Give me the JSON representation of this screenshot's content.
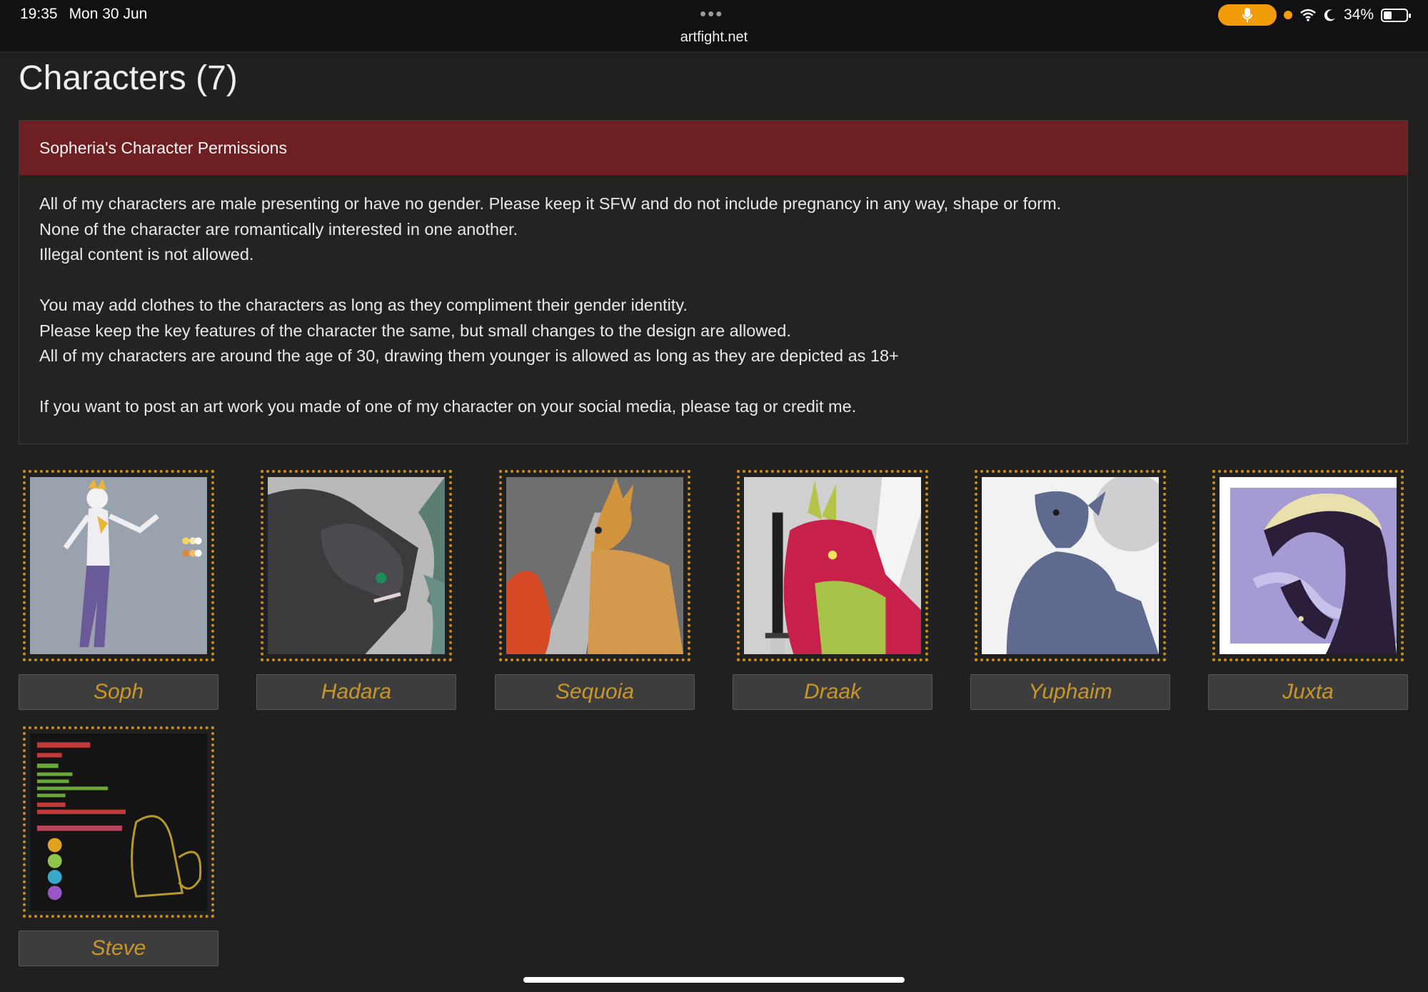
{
  "status_bar": {
    "time": "19:35",
    "date": "Mon 30 Jun",
    "url": "artfight.net",
    "battery": "34%"
  },
  "page": {
    "title": "Characters (7)"
  },
  "permissions": {
    "header": "Sopheria's Character Permissions",
    "lines": [
      "All of my characters are male presenting or have no gender. Please keep it SFW and do not include pregnancy in any way, shape or form.",
      "None of the character are romantically interested in one another.",
      "Illegal content is not allowed.",
      "You may add clothes to the characters as long as they compliment their gender identity.",
      "Please keep the key features of the character the same, but small changes to the design are allowed.",
      "All of my characters are around the age of 30, drawing them younger is allowed as long as they are depicted as 18+",
      "If you want to post an art work you made of one of my character on your social media, please tag or credit me."
    ]
  },
  "characters": [
    {
      "name": "Soph"
    },
    {
      "name": "Hadara"
    },
    {
      "name": "Sequoia"
    },
    {
      "name": "Draak"
    },
    {
      "name": "Yuphaim"
    },
    {
      "name": "Juxta"
    },
    {
      "name": "Steve"
    }
  ],
  "colors": {
    "accent": "#c9962a",
    "header_bg": "#6e1f22",
    "page_bg": "#202020"
  }
}
